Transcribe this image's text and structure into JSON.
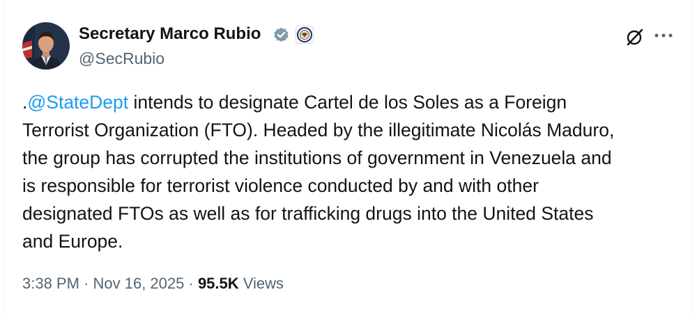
{
  "author": {
    "display_name": "Secretary Marco Rubio",
    "handle": "@SecRubio"
  },
  "icons": {
    "verified": "verified-badge-icon",
    "affiliation": "state-department-seal-icon",
    "grok": "grok-icon",
    "more": "more-options-icon"
  },
  "colors": {
    "link": "#1d9bf0",
    "text": "#0f1419",
    "secondary": "#536471",
    "verified_gray": "#829aab"
  },
  "tweet": {
    "lines": [
      {
        "prefix": ".",
        "mention": "@StateDept",
        "text": " intends to designate Cartel de los Soles as a Foreign"
      },
      {
        "text": "Terrorist Organization (FTO). Headed by the illegitimate Nicolás Maduro,"
      },
      {
        "text": "the group has corrupted the institutions of government in Venezuela and"
      },
      {
        "text": "is responsible for terrorist violence conducted by and with other"
      },
      {
        "text": "designated FTOs as well as for trafficking drugs into the United States"
      },
      {
        "text": "and Europe."
      }
    ]
  },
  "meta": {
    "time": "3:38 PM",
    "separator": " · ",
    "date": "Nov 16, 2025",
    "views_count": "95.5K",
    "views_label": " Views"
  }
}
